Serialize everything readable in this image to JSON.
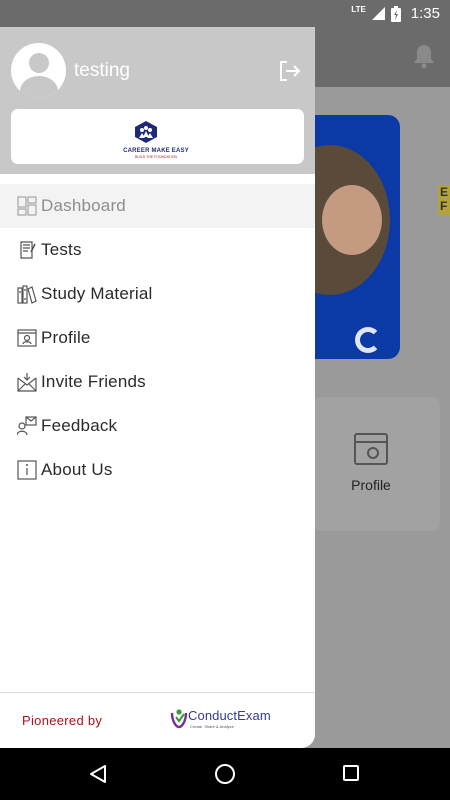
{
  "status_bar": {
    "network": "LTE",
    "time": "1:35"
  },
  "background": {
    "card_label": "Profile",
    "promo_text": "E F"
  },
  "drawer": {
    "user_name": "testing",
    "brand": {
      "title": "CAREER MAKE EASY",
      "tagline": "BUILD THE FOUNDATION"
    },
    "menu": [
      {
        "label": "Dashboard",
        "icon": "dashboard-icon",
        "active": true
      },
      {
        "label": "Tests",
        "icon": "tests-icon"
      },
      {
        "label": "Study Material",
        "icon": "books-icon"
      },
      {
        "label": "Profile",
        "icon": "profile-icon"
      },
      {
        "label": "Invite Friends",
        "icon": "invite-icon"
      },
      {
        "label": "Feedback",
        "icon": "feedback-icon"
      },
      {
        "label": "About Us",
        "icon": "info-icon"
      }
    ],
    "footer": {
      "pioneered_label": "Pioneered by",
      "partner_name": "ConductExam",
      "partner_tagline": "Create, Share & Analyze"
    }
  },
  "colors": {
    "accent_red": "#b0101a",
    "brand_blue": "#1e2a78",
    "header_grey": "#c8c8c8"
  }
}
